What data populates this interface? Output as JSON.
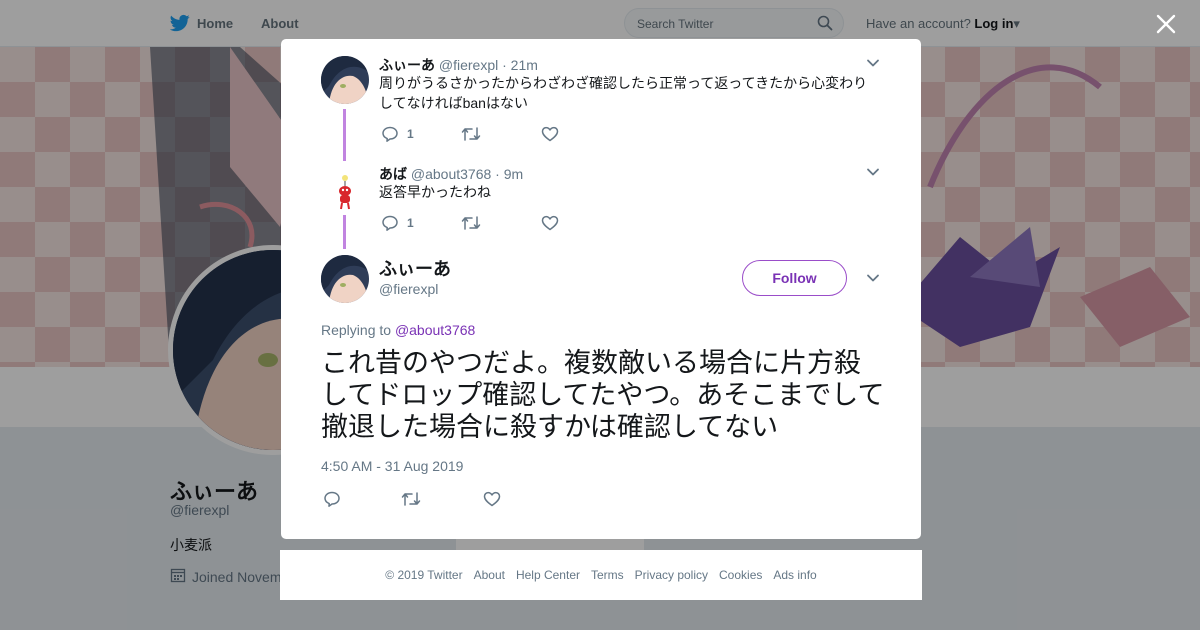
{
  "topbar": {
    "home_label": "Home",
    "about_label": "About",
    "search_placeholder": "Search Twitter",
    "account_prompt": "Have an account?",
    "login_label": "Log in"
  },
  "profile": {
    "name": "ふぃーあ",
    "handle": "@fierexpl",
    "bio": "小麦派",
    "joined": "Joined Novem",
    "ads_info": "Ads info"
  },
  "modal": {
    "tweets": [
      {
        "name": "ふぃーあ",
        "handle": "@fierexpl",
        "time": "· 21m",
        "text": "周りがうるさかったからわざわざ確認したら正常って返ってきたから心変わりしてなければbanはない",
        "reply_count": "1"
      },
      {
        "name": "あば",
        "handle": "@about3768",
        "time": "· 9m",
        "text": "返答早かったわね",
        "reply_count": "1"
      }
    ],
    "main_tweet": {
      "name": "ふぃーあ",
      "handle": "@fierexpl",
      "follow_label": "Follow",
      "replying_prefix": "Replying to",
      "replying_to": "@about3768",
      "text": "これ昔のやつだよ。複数敵いる場合に片方殺してドロップ確認してたやつ。あそこまでして撤退した場合に殺すかは確認してない",
      "timestamp": "4:50 AM - 31 Aug 2019"
    }
  },
  "footer": {
    "links": [
      "© 2019 Twitter",
      "About",
      "Help Center",
      "Terms",
      "Privacy policy",
      "Cookies",
      "Ads info"
    ]
  },
  "colors": {
    "twitter_blue": "#1da1f2",
    "accent_purple": "#7a32b5",
    "thread_line": "#c184e0"
  },
  "icons": [
    "twitter-bird-icon",
    "search-icon",
    "caret-down-icon",
    "close-icon",
    "reply-icon",
    "retweet-icon",
    "like-icon",
    "calendar-icon"
  ]
}
